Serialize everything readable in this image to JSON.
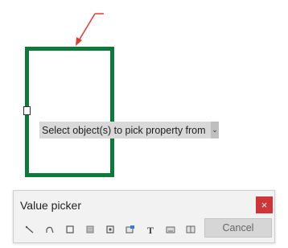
{
  "canvas": {
    "tooltip": {
      "label": "Select object(s) to pick property from",
      "dropdown_icon": "chevron-down-icon"
    },
    "colors": {
      "shape_stroke": "#0e7a3a",
      "arrow": "#e03c31"
    }
  },
  "value_picker": {
    "title": "Value picker",
    "close_label": "×",
    "cancel_label": "Cancel",
    "tools": [
      {
        "name": "line-tool-icon"
      },
      {
        "name": "curve-tool-icon"
      },
      {
        "name": "rectangle-tool-icon"
      },
      {
        "name": "fill-tool-icon"
      },
      {
        "name": "shape-tool-icon"
      },
      {
        "name": "image-tool-icon"
      },
      {
        "name": "text-tool-icon"
      },
      {
        "name": "keyboard-tool-icon"
      },
      {
        "name": "book-tool-icon"
      }
    ]
  }
}
